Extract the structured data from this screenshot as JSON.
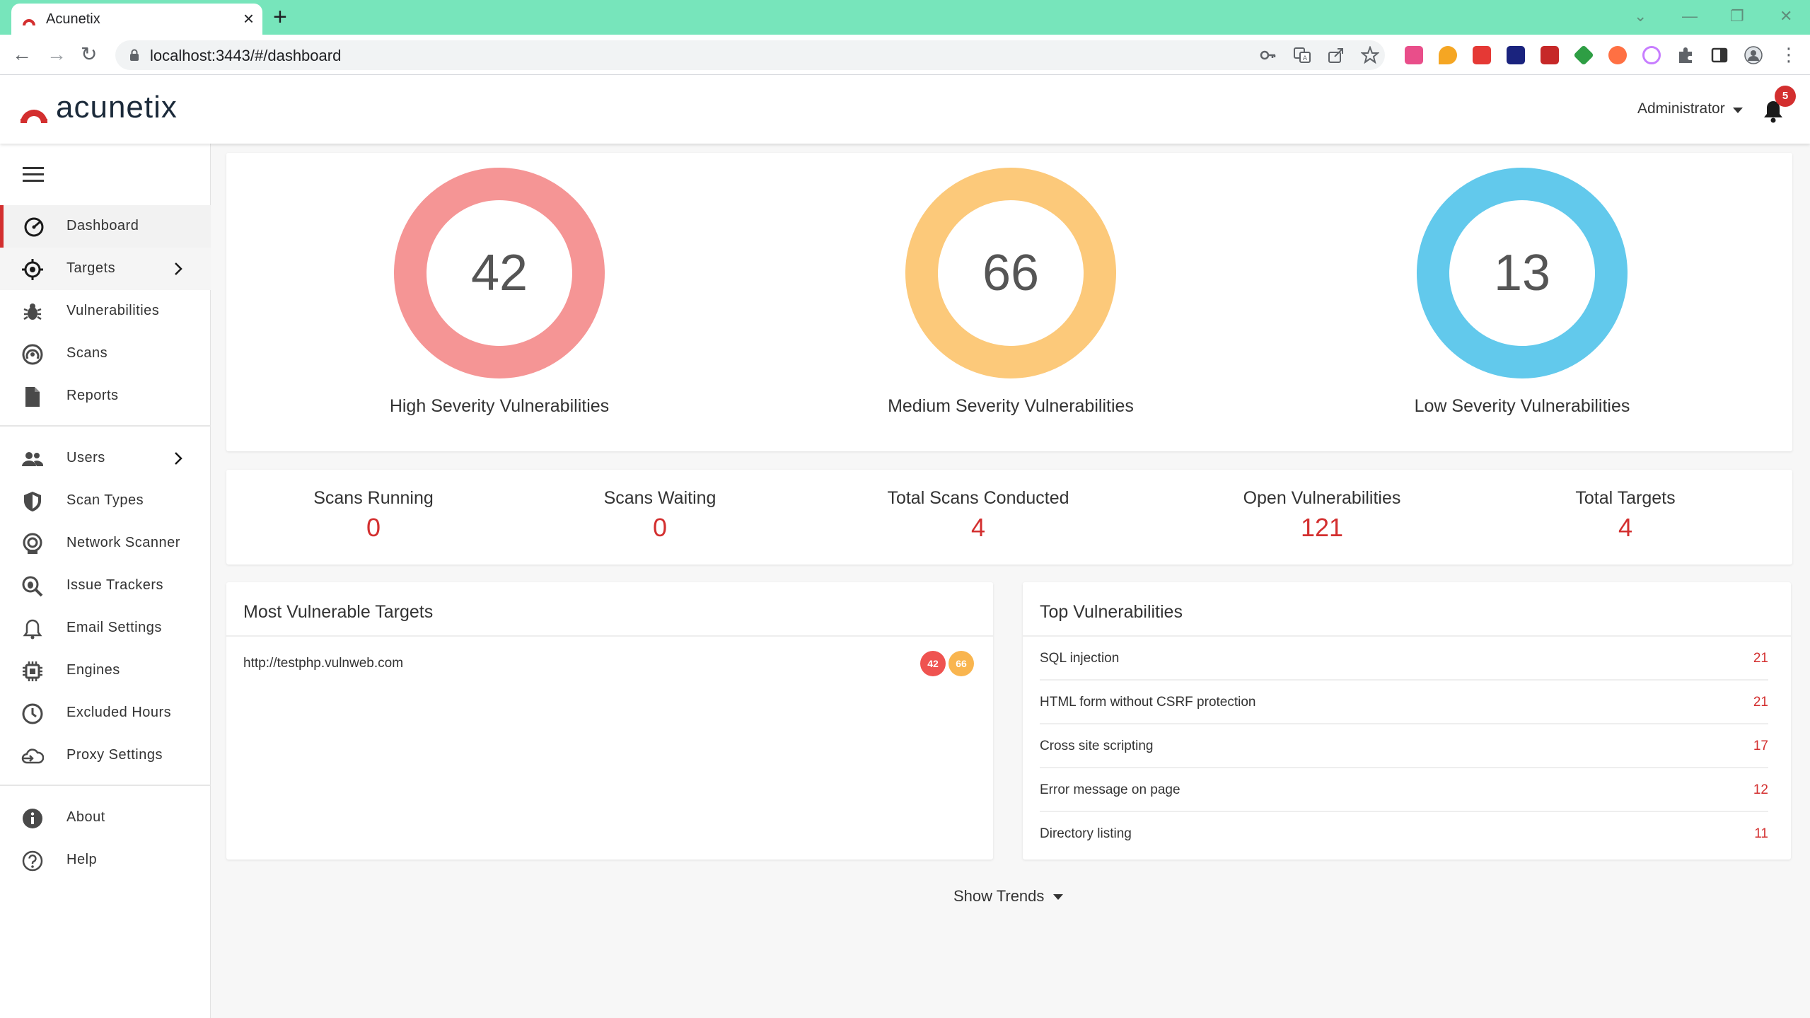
{
  "browser": {
    "tab_title": "Acunetix",
    "url": "localhost:3443/#/dashboard"
  },
  "header": {
    "logo_text": "acunetix",
    "user_label": "Administrator",
    "notification_count": "5"
  },
  "sidebar": {
    "items": [
      {
        "label": "Dashboard",
        "icon": "dashboard-icon"
      },
      {
        "label": "Targets",
        "icon": "target-icon"
      },
      {
        "label": "Vulnerabilities",
        "icon": "bug-icon"
      },
      {
        "label": "Scans",
        "icon": "scan-icon"
      },
      {
        "label": "Reports",
        "icon": "report-icon"
      },
      {
        "label": "Users",
        "icon": "users-icon"
      },
      {
        "label": "Scan Types",
        "icon": "shield-icon"
      },
      {
        "label": "Network Scanner",
        "icon": "network-scanner-icon"
      },
      {
        "label": "Issue Trackers",
        "icon": "issue-tracker-icon"
      },
      {
        "label": "Email Settings",
        "icon": "bell-icon"
      },
      {
        "label": "Engines",
        "icon": "chip-icon"
      },
      {
        "label": "Excluded Hours",
        "icon": "clock-icon"
      },
      {
        "label": "Proxy Settings",
        "icon": "cloud-icon"
      },
      {
        "label": "About",
        "icon": "info-icon"
      },
      {
        "label": "Help",
        "icon": "help-icon"
      }
    ]
  },
  "severity": {
    "high": {
      "value": "42",
      "label": "High Severity Vulnerabilities",
      "color": "#f59595"
    },
    "medium": {
      "value": "66",
      "label": "Medium Severity Vulnerabilities",
      "color": "#fcc97a"
    },
    "low": {
      "value": "13",
      "label": "Low Severity Vulnerabilities",
      "color": "#62c9ec"
    }
  },
  "stats": [
    {
      "label": "Scans Running",
      "value": "0"
    },
    {
      "label": "Scans Waiting",
      "value": "0"
    },
    {
      "label": "Total Scans Conducted",
      "value": "4"
    },
    {
      "label": "Open Vulnerabilities",
      "value": "121"
    },
    {
      "label": "Total Targets",
      "value": "4"
    }
  ],
  "most_vulnerable": {
    "title": "Most Vulnerable Targets",
    "targets": [
      {
        "url": "http://testphp.vulnweb.com",
        "high": "42",
        "medium": "66"
      }
    ]
  },
  "top_vulnerabilities": {
    "title": "Top Vulnerabilities",
    "items": [
      {
        "name": "SQL injection",
        "count": "21"
      },
      {
        "name": "HTML form without CSRF protection",
        "count": "21"
      },
      {
        "name": "Cross site scripting",
        "count": "17"
      },
      {
        "name": "Error message on page",
        "count": "12"
      },
      {
        "name": "Directory listing",
        "count": "11"
      }
    ]
  },
  "show_trends_label": "Show Trends",
  "colors": {
    "accent": "#d32f2f",
    "tabbar": "#77e5bb"
  }
}
